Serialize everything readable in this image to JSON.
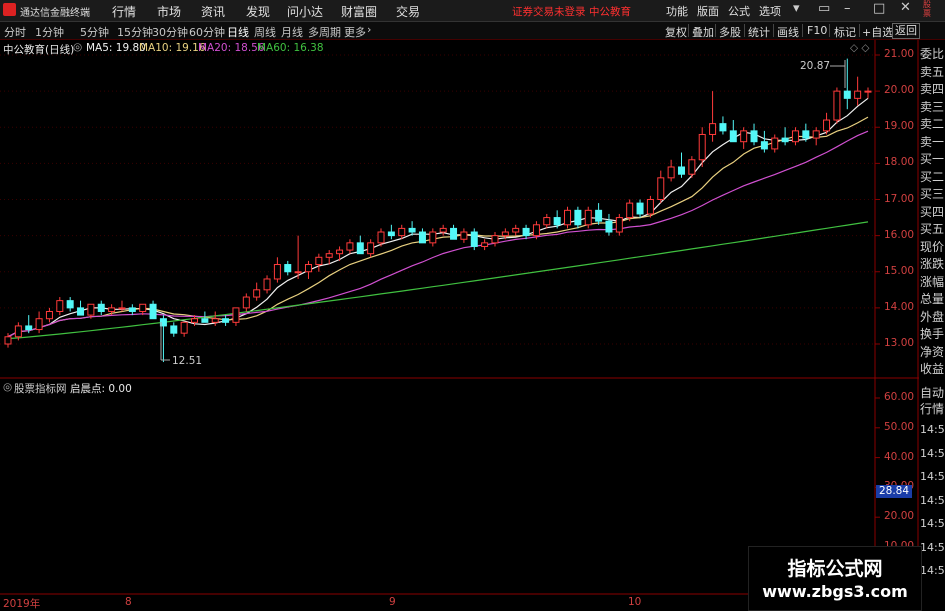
{
  "app": {
    "title": "通达信金融终端",
    "menus": [
      "行情",
      "市场",
      "资讯",
      "发现",
      "问小达",
      "财富圈",
      "交易"
    ],
    "status_text": "证券交易未登录",
    "status_user": "中公教育",
    "right_menus": [
      "功能",
      "版面",
      "公式",
      "选项"
    ],
    "colors": {
      "bg": "#000000",
      "up": "#ff3b3b",
      "down": "#53f7f7",
      "axis": "#8a0000"
    }
  },
  "toolbar": {
    "periods": [
      "分时",
      "1分钟",
      "5分钟",
      "15分钟",
      "30分钟",
      "60分钟",
      "日线",
      "周线",
      "月线",
      "多周期",
      "更多"
    ],
    "active_period": "日线",
    "right_buttons": [
      "复权",
      "叠加",
      "多股",
      "统计",
      "画线",
      "F10",
      "标记",
      "+自选",
      "返回"
    ]
  },
  "main_chart": {
    "name": "中公教育(日线)",
    "ma": [
      {
        "label": "MA5: 19.80",
        "color": "#f0f0f0"
      },
      {
        "label": "MA10: 19.16",
        "color": "#e8d080"
      },
      {
        "label": "MA20: 18.56",
        "color": "#d050d0"
      },
      {
        "label": "MA60: 16.38",
        "color": "#40c040"
      }
    ],
    "high_mark": "20.87",
    "low_mark": "12.51",
    "price_ticks": [
      "21.00",
      "20.00",
      "19.00",
      "18.00",
      "17.00",
      "16.00",
      "15.00",
      "14.00",
      "13.00"
    ]
  },
  "side_panel": {
    "labels": [
      "委比",
      "卖五",
      "卖四",
      "卖三",
      "卖二",
      "卖一",
      "买一",
      "买二",
      "买三",
      "买四",
      "买五",
      "现价",
      "涨跌",
      "涨幅",
      "总量",
      "外盘",
      "换手",
      "净资",
      "收益"
    ],
    "top_labels": [
      "股",
      "票"
    ],
    "lower": [
      "自动",
      "行情"
    ],
    "times": [
      "14:50",
      "14:50",
      "14:50",
      "14:50",
      "14:50",
      "14:50",
      "14:50"
    ]
  },
  "sub_chart": {
    "name": "股票指标网",
    "indicator_label": "启晨点: 0.00",
    "ticks": [
      "60.00",
      "50.00",
      "40.00",
      "30.00",
      "20.00",
      "10.00"
    ],
    "current_value": "28.84"
  },
  "date_axis": [
    "2019年",
    "8",
    "9",
    "10"
  ],
  "watermark": {
    "line1": "指标公式网",
    "line2": "www.zbgs3.com"
  },
  "chart_data": {
    "type": "candlestick",
    "y_axis_range": [
      12.3,
      21.6
    ],
    "ohlc": [
      [
        13.0,
        13.3,
        12.9,
        13.2
      ],
      [
        13.2,
        13.6,
        13.1,
        13.5
      ],
      [
        13.5,
        13.8,
        13.3,
        13.4
      ],
      [
        13.4,
        13.9,
        13.3,
        13.7
      ],
      [
        13.7,
        14.0,
        13.6,
        13.9
      ],
      [
        13.9,
        14.3,
        13.8,
        14.2
      ],
      [
        14.2,
        14.3,
        13.9,
        14.0
      ],
      [
        14.0,
        14.2,
        13.8,
        13.8
      ],
      [
        13.8,
        14.1,
        13.7,
        14.1
      ],
      [
        14.1,
        14.2,
        13.8,
        13.9
      ],
      [
        13.9,
        14.1,
        13.8,
        14.0
      ],
      [
        14.0,
        14.2,
        13.9,
        14.0
      ],
      [
        14.0,
        14.1,
        13.8,
        13.9
      ],
      [
        13.9,
        14.1,
        13.8,
        14.1
      ],
      [
        14.1,
        14.2,
        13.7,
        13.7
      ],
      [
        13.7,
        13.8,
        12.5,
        13.5
      ],
      [
        13.5,
        13.6,
        13.2,
        13.3
      ],
      [
        13.3,
        13.6,
        13.2,
        13.6
      ],
      [
        13.6,
        13.8,
        13.5,
        13.7
      ],
      [
        13.7,
        13.9,
        13.6,
        13.6
      ],
      [
        13.6,
        13.9,
        13.5,
        13.7
      ],
      [
        13.7,
        13.8,
        13.5,
        13.6
      ],
      [
        13.6,
        14.0,
        13.5,
        14.0
      ],
      [
        14.0,
        14.4,
        13.9,
        14.3
      ],
      [
        14.3,
        14.7,
        14.2,
        14.5
      ],
      [
        14.5,
        14.9,
        14.4,
        14.8
      ],
      [
        14.8,
        15.4,
        14.7,
        15.2
      ],
      [
        15.2,
        15.3,
        14.9,
        15.0
      ],
      [
        15.0,
        16.0,
        14.8,
        15.0
      ],
      [
        15.0,
        15.3,
        14.8,
        15.2
      ],
      [
        15.2,
        15.5,
        15.0,
        15.4
      ],
      [
        15.4,
        15.6,
        15.2,
        15.5
      ],
      [
        15.5,
        15.7,
        15.3,
        15.6
      ],
      [
        15.6,
        15.9,
        15.5,
        15.8
      ],
      [
        15.8,
        16.0,
        15.5,
        15.5
      ],
      [
        15.5,
        15.9,
        15.4,
        15.8
      ],
      [
        15.8,
        16.2,
        15.7,
        16.1
      ],
      [
        16.1,
        16.3,
        15.9,
        16.0
      ],
      [
        16.0,
        16.3,
        15.9,
        16.2
      ],
      [
        16.2,
        16.4,
        16.0,
        16.1
      ],
      [
        16.1,
        16.2,
        15.8,
        15.8
      ],
      [
        15.8,
        16.2,
        15.7,
        16.1
      ],
      [
        16.1,
        16.3,
        16.0,
        16.2
      ],
      [
        16.2,
        16.3,
        15.9,
        15.9
      ],
      [
        15.9,
        16.2,
        15.8,
        16.1
      ],
      [
        16.1,
        16.2,
        15.6,
        15.7
      ],
      [
        15.7,
        15.9,
        15.6,
        15.8
      ],
      [
        15.8,
        16.1,
        15.7,
        16.0
      ],
      [
        16.0,
        16.2,
        15.9,
        16.1
      ],
      [
        16.1,
        16.3,
        16.0,
        16.2
      ],
      [
        16.2,
        16.3,
        15.9,
        16.0
      ],
      [
        16.0,
        16.4,
        15.9,
        16.3
      ],
      [
        16.3,
        16.6,
        16.2,
        16.5
      ],
      [
        16.5,
        16.7,
        16.2,
        16.3
      ],
      [
        16.3,
        16.8,
        16.2,
        16.7
      ],
      [
        16.7,
        16.8,
        16.2,
        16.3
      ],
      [
        16.3,
        16.8,
        16.2,
        16.7
      ],
      [
        16.7,
        16.9,
        16.3,
        16.4
      ],
      [
        16.4,
        16.6,
        16.0,
        16.1
      ],
      [
        16.1,
        16.6,
        16.0,
        16.5
      ],
      [
        16.5,
        17.0,
        16.4,
        16.9
      ],
      [
        16.9,
        17.0,
        16.5,
        16.6
      ],
      [
        16.6,
        17.1,
        16.5,
        17.0
      ],
      [
        17.0,
        17.8,
        16.9,
        17.6
      ],
      [
        17.6,
        18.1,
        17.5,
        17.9
      ],
      [
        17.9,
        18.3,
        17.6,
        17.7
      ],
      [
        17.7,
        18.2,
        17.6,
        18.1
      ],
      [
        18.1,
        19.0,
        17.9,
        18.8
      ],
      [
        18.8,
        20.0,
        18.6,
        19.1
      ],
      [
        19.1,
        19.3,
        18.8,
        18.9
      ],
      [
        18.9,
        19.2,
        18.6,
        18.6
      ],
      [
        18.6,
        19.0,
        18.4,
        18.9
      ],
      [
        18.9,
        19.1,
        18.5,
        18.6
      ],
      [
        18.6,
        18.9,
        18.3,
        18.4
      ],
      [
        18.4,
        18.8,
        18.3,
        18.7
      ],
      [
        18.7,
        19.0,
        18.5,
        18.6
      ],
      [
        18.6,
        19.0,
        18.5,
        18.9
      ],
      [
        18.9,
        19.1,
        18.6,
        18.7
      ],
      [
        18.7,
        19.0,
        18.5,
        18.9
      ],
      [
        18.9,
        19.4,
        18.8,
        19.2
      ],
      [
        19.2,
        20.1,
        19.1,
        20.0
      ],
      [
        20.0,
        20.9,
        19.5,
        19.8
      ],
      [
        19.8,
        20.4,
        19.6,
        20.0
      ],
      [
        20.0,
        20.1,
        19.8,
        20.0
      ]
    ]
  }
}
